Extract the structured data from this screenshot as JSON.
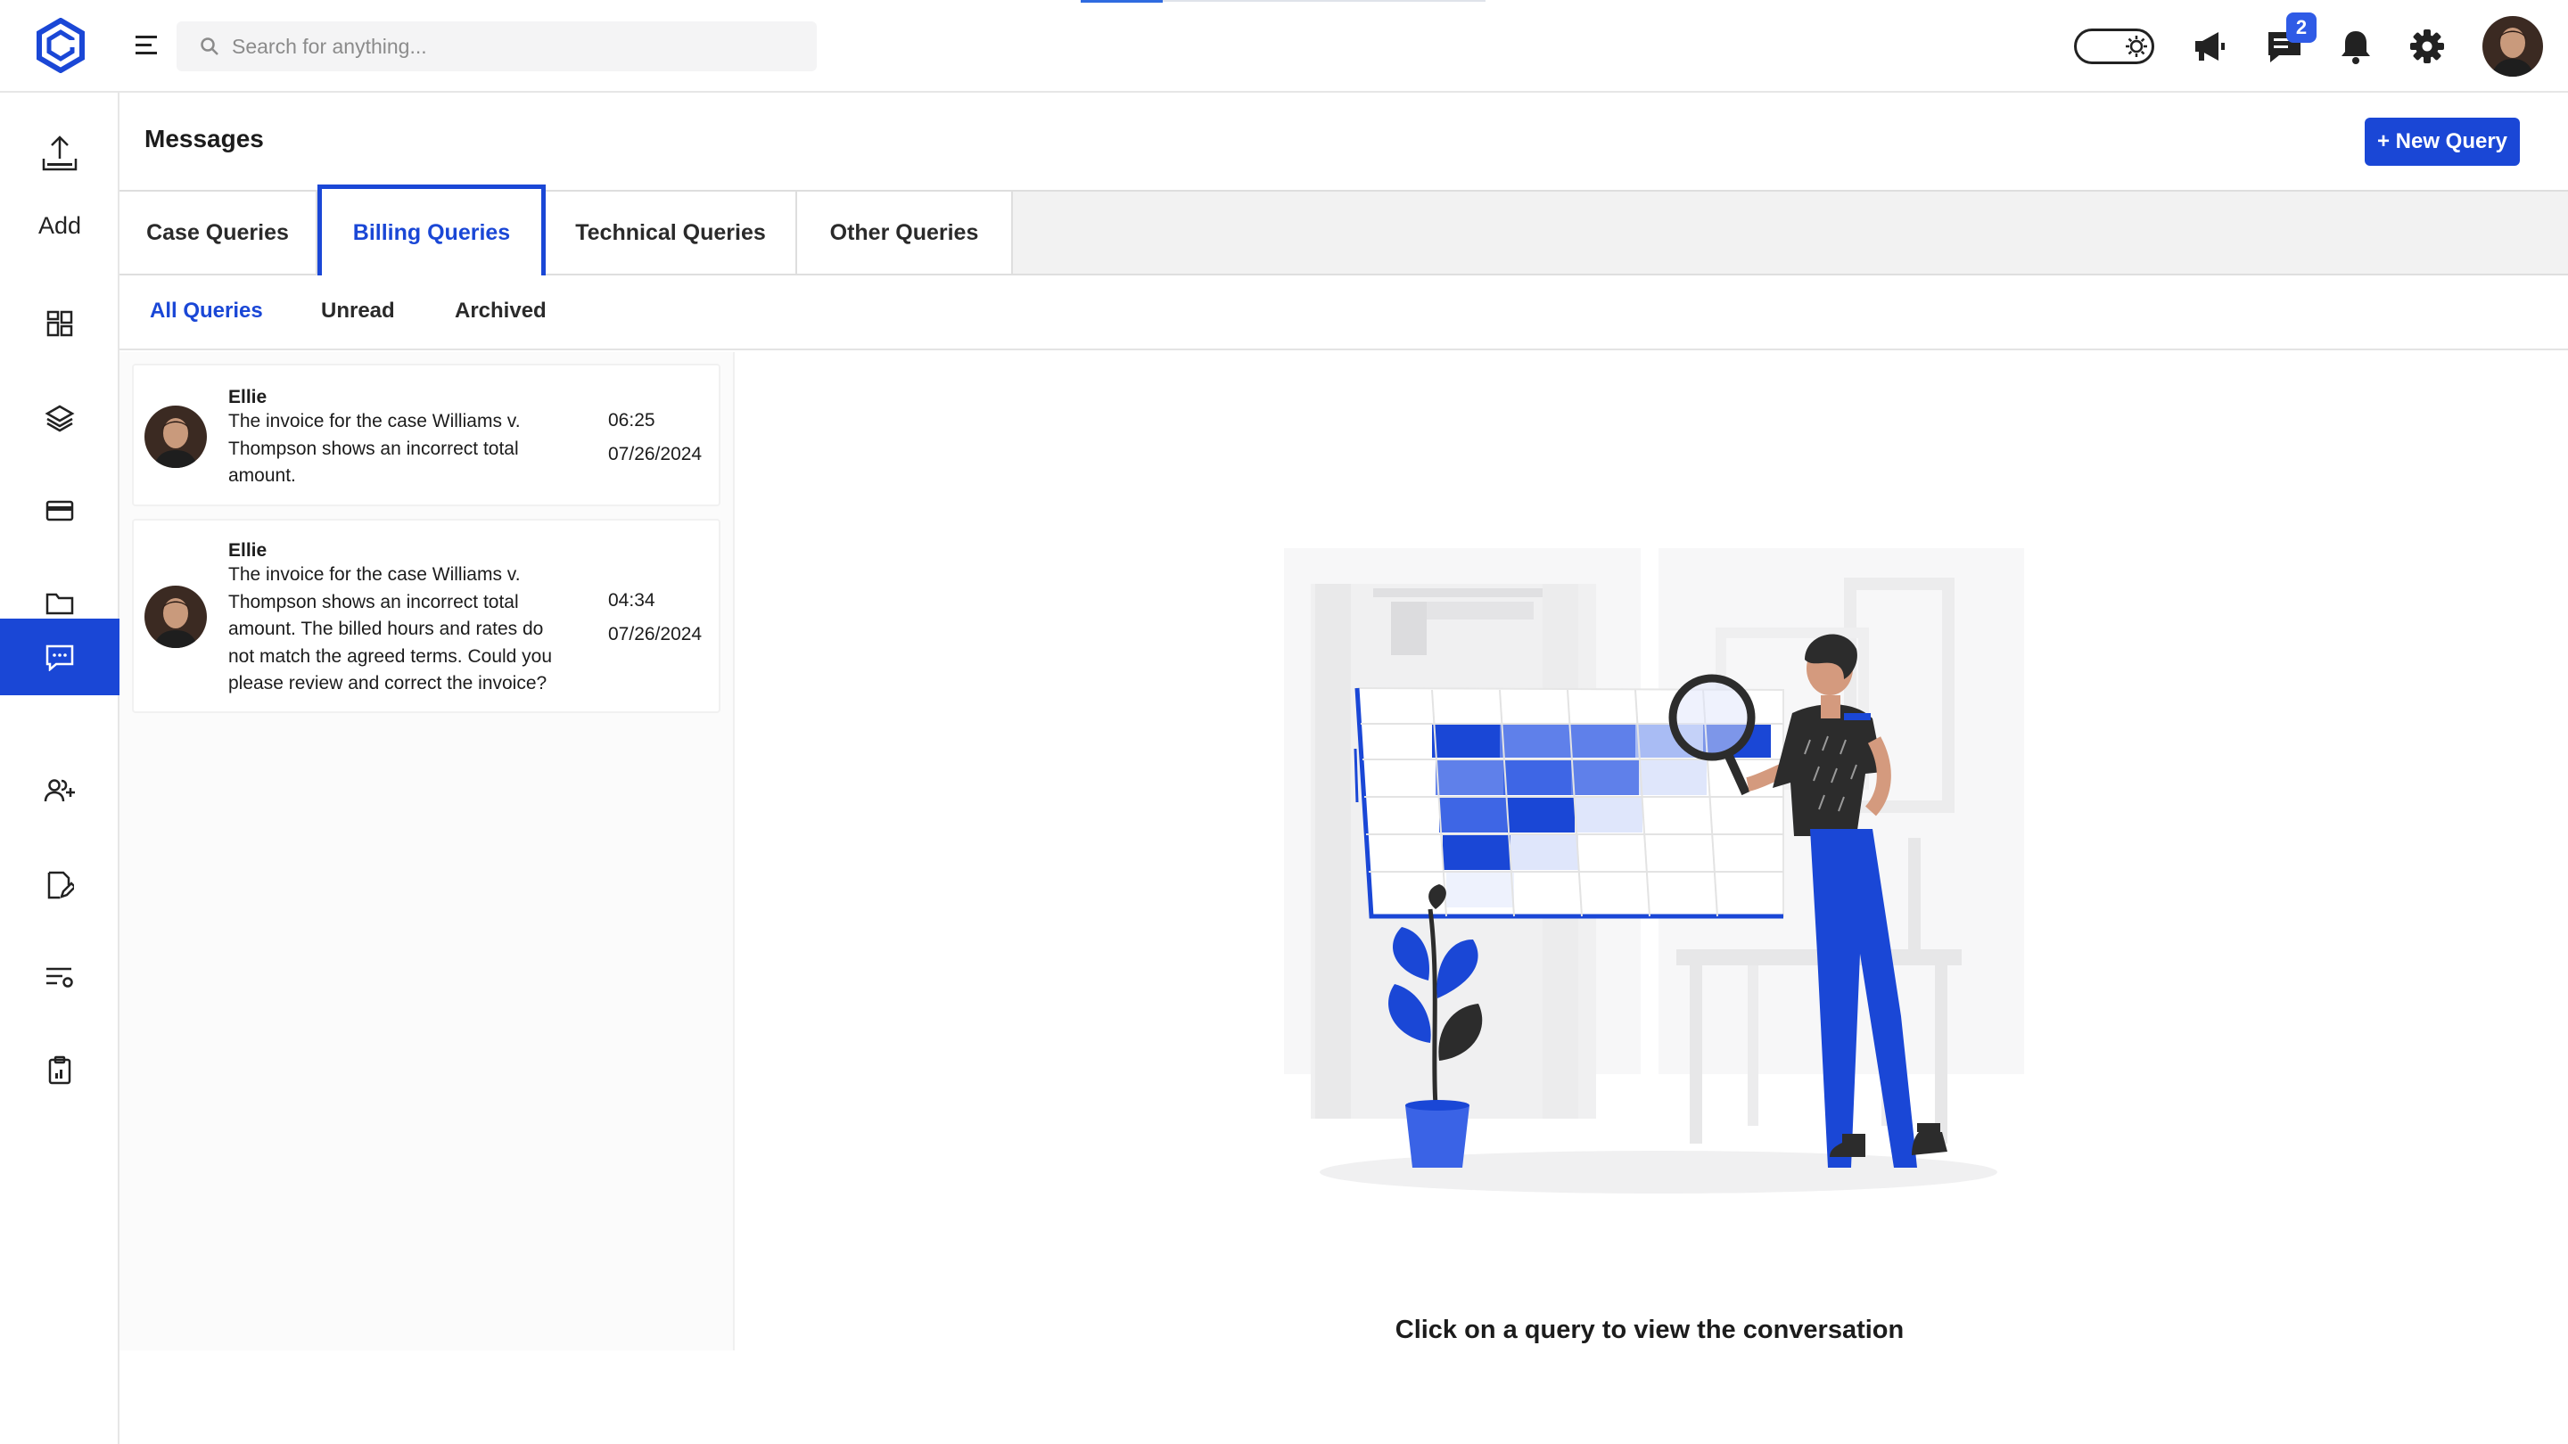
{
  "topbar": {
    "search_placeholder": "Search for anything...",
    "chat_badge_count": "2"
  },
  "sidebar": {
    "add_label": "Add",
    "items": [
      {
        "icon": "dashboard-icon",
        "active": false
      },
      {
        "icon": "layers-icon",
        "active": false
      },
      {
        "icon": "card-icon",
        "active": false
      },
      {
        "icon": "folder-icon",
        "active": false
      },
      {
        "icon": "chat-icon",
        "active": true
      },
      {
        "icon": "users-add-icon",
        "active": false
      },
      {
        "icon": "edit-document-icon",
        "active": false
      },
      {
        "icon": "filter-settings-icon",
        "active": false
      },
      {
        "icon": "clipboard-icon",
        "active": false
      }
    ]
  },
  "page": {
    "title": "Messages",
    "new_query_label": "+ New Query"
  },
  "tabs": [
    {
      "label": "Case Queries",
      "active": false
    },
    {
      "label": "Billing Queries",
      "active": true
    },
    {
      "label": "Technical Queries",
      "active": false
    },
    {
      "label": "Other Queries",
      "active": false
    }
  ],
  "subtabs": [
    {
      "label": "All Queries",
      "active": true
    },
    {
      "label": "Unread",
      "active": false
    },
    {
      "label": "Archived",
      "active": false
    }
  ],
  "messages": [
    {
      "name": "Ellie",
      "lines": [
        "The invoice for the case Williams v.",
        "Thompson shows an incorrect total",
        "amount."
      ],
      "time": "06:25",
      "date": "07/26/2024"
    },
    {
      "name": "Ellie",
      "lines": [
        "The invoice for the case Williams v.",
        "Thompson shows an incorrect total",
        "amount. The billed hours and rates do",
        "not match the agreed terms. Could you",
        "please review and correct the invoice?"
      ],
      "time": "04:34",
      "date": "07/26/2024"
    }
  ],
  "empty_state": {
    "text": "Click on a query to view the conversation"
  },
  "colors": {
    "accent": "#1a47d6",
    "active_tab_border": "#1a47d6"
  }
}
